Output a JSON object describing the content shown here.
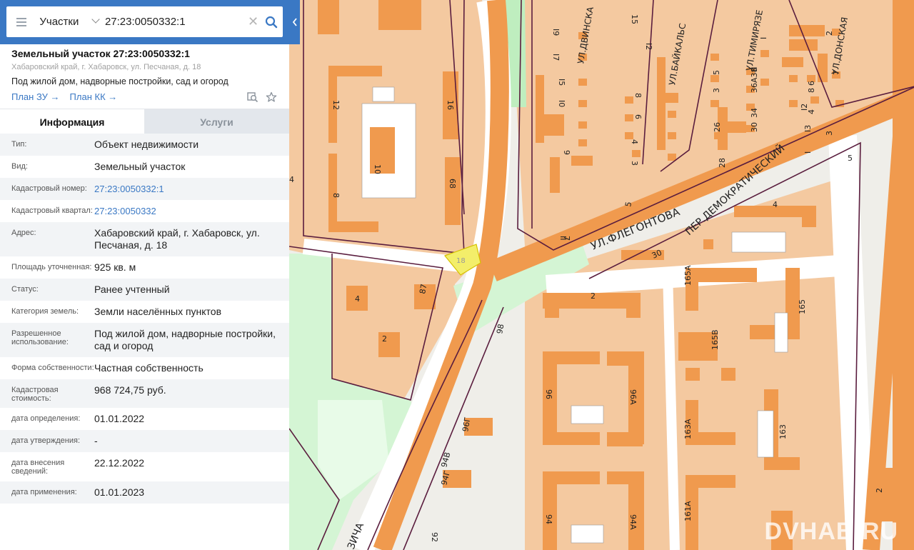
{
  "search": {
    "category": "Участки",
    "query": "27:23:0050332:1"
  },
  "parcel": {
    "title": "Земельный участок 27:23:0050332:1",
    "address": "Хабаровский край, г. Хабаровск, ул. Песчаная, д. 18",
    "purpose": "Под жилой дом, надворные постройки, сад и огород",
    "link_plan_zu": "План ЗУ",
    "link_plan_kk": "План КК"
  },
  "tabs": {
    "info": "Информация",
    "services": "Услуги"
  },
  "rows": [
    {
      "label": "Тип:",
      "value": "Объект недвижимости"
    },
    {
      "label": "Вид:",
      "value": "Земельный участок"
    },
    {
      "label": "Кадастровый номер:",
      "value": "27:23:0050332:1"
    },
    {
      "label": "Кадастровый квартал:",
      "value": "27:23:0050332"
    },
    {
      "label": "Адрес:",
      "value": "Хабаровский край, г. Хабаровск, ул. Песчаная, д. 18"
    },
    {
      "label": "Площадь уточненная:",
      "value": "925 кв. м"
    },
    {
      "label": "Статус:",
      "value": "Ранее учтенный"
    },
    {
      "label": "Категория земель:",
      "value": "Земли населённых пунктов"
    },
    {
      "label": "Разрешенное использование:",
      "value": "Под жилой дом, надворные постройки, сад и огород"
    },
    {
      "label": "Форма собственности:",
      "value": "Частная собственность"
    },
    {
      "label": "Кадастровая стоимость:",
      "value": "968 724,75 руб."
    },
    {
      "label": "дата определения:",
      "value": "01.01.2022"
    },
    {
      "label": "дата утверждения:",
      "value": "-"
    },
    {
      "label": "дата внесения сведений:",
      "value": "22.12.2022"
    },
    {
      "label": "дата применения:",
      "value": "01.01.2023"
    }
  ],
  "map": {
    "streets": {
      "flegontova": "УЛ.ФЛЕГОНТОВА",
      "demokraticheskaya": "ПЕР.ДЕМОКРАТИЧЕСКИЙ",
      "dvinskaya": "УЛ.ДВИНСКА",
      "baykalskaya": "УЛ.БАЙКАЛЬС",
      "timiryazeva": "УЛ.ТИМИРЯЗЕ",
      "donskaya": "УЛ.ДОНСКАЯ",
      "bottom_street": "ЗИЧА"
    },
    "selected_parcel_label": "18",
    "house_numbers": [
      "12",
      "16",
      "10",
      "8",
      "68",
      "4",
      "87",
      "2",
      "98",
      "96",
      "96А",
      "96Г",
      "94В",
      "94Г",
      "94",
      "94А",
      "92",
      "2",
      "165А",
      "165",
      "165В",
      "163А",
      "163",
      "161А",
      "30",
      "4",
      "II",
      "15",
      "I2",
      "I9",
      "I7",
      "I5",
      "I0",
      "9",
      "8",
      "6",
      "4",
      "3",
      "5",
      "7",
      "I",
      "II",
      "36А38",
      "34",
      "30",
      "28",
      "26",
      "3",
      "5",
      "7",
      "2",
      "4",
      "6",
      "8",
      "I2",
      "I3",
      "I",
      "3",
      "5",
      "2",
      "4",
      "I8",
      "96",
      "3/"
    ],
    "colors": {
      "background": "#efeee9",
      "block": "#f4c9a0",
      "building": "#f09a4e",
      "road": "#ffffff",
      "major_road": "#f09a4e",
      "green": "#d4f5d4",
      "boundary": "#5a1d3e",
      "selected": "#f3ee6a"
    },
    "watermark": "DVHAB.RU"
  },
  "accent": "#3a78c4"
}
